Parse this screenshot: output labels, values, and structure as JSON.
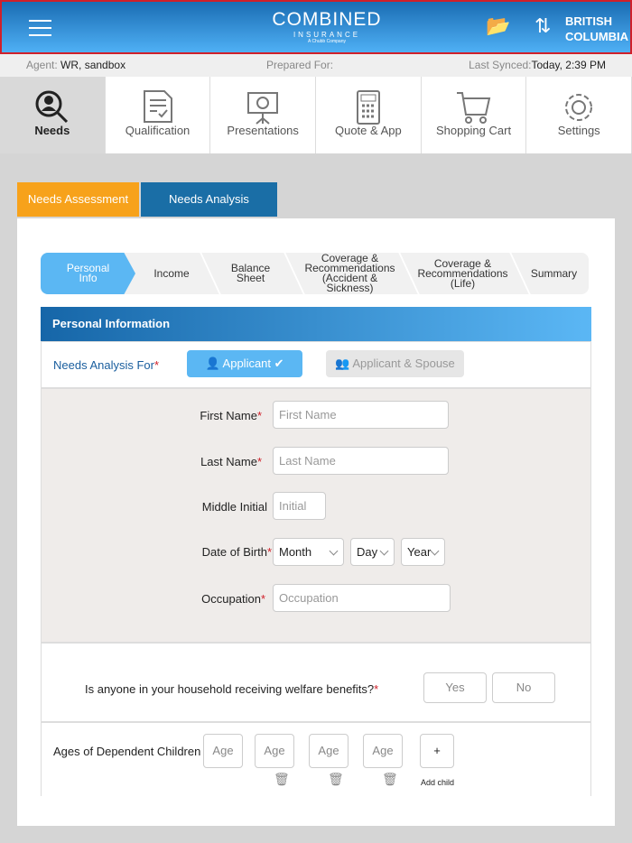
{
  "header": {
    "logo_main": "COMBINED",
    "logo_sub": "INSURANCE",
    "logo_tag": "A Chubb Company",
    "province_line1": "BRITISH",
    "province_line2": "COLUMBIA"
  },
  "info": {
    "agent_label": "Agent:",
    "agent_value": "WR, sandbox",
    "prepared_label": "Prepared For:",
    "synced_label": "Last Synced:",
    "synced_value": "Today, 2:39 PM"
  },
  "nav": [
    {
      "label": "Needs"
    },
    {
      "label": "Qualification"
    },
    {
      "label": "Presentations"
    },
    {
      "label": "Quote & App"
    },
    {
      "label": "Shopping Cart"
    },
    {
      "label": "Settings"
    }
  ],
  "tabs": {
    "assessment": "Needs Assessment",
    "analysis": "Needs Analysis"
  },
  "steps": [
    "Personal Info",
    "Income",
    "Balance Sheet",
    "Coverage & Recommendations (Accident & Sickness)",
    "Coverage & Recommendations (Life)",
    "Summary"
  ],
  "section": {
    "title": "Personal Information",
    "for_label": "Needs Analysis For",
    "applicant": "Applicant",
    "applicant_spouse": "Applicant & Spouse"
  },
  "form": {
    "first_label": "First Name",
    "first_ph": "First Name",
    "last_label": "Last Name",
    "last_ph": "Last Name",
    "middle_label": "Middle Initial",
    "middle_ph": "Initial",
    "dob_label": "Date of Birth",
    "month": "Month",
    "day": "Day",
    "year": "Year",
    "occ_label": "Occupation",
    "occ_ph": "Occupation"
  },
  "welfare": {
    "question": "Is anyone in your household receiving welfare benefits?",
    "yes": "Yes",
    "no": "No"
  },
  "children": {
    "label": "Ages of Dependent Children",
    "age_ph": "Age",
    "add": "+",
    "add_label": "Add child"
  },
  "colors": {
    "orange": "#f7a21b",
    "dark_blue": "#1a6ea6",
    "light_blue": "#5bb7f3"
  }
}
